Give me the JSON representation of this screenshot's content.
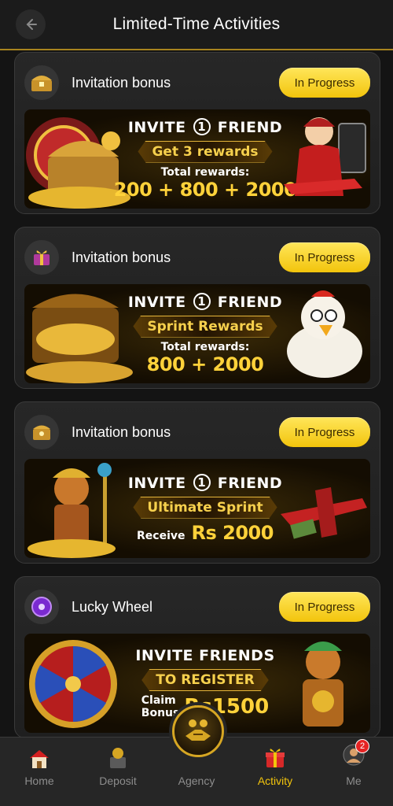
{
  "header": {
    "title": "Limited-Time Activities"
  },
  "activities": [
    {
      "title": "Invitation bonus",
      "status": "In Progress",
      "icon": "treasure-chest-icon",
      "banner": {
        "line1_pre": "INVITE",
        "line1_num": "1",
        "line1_post": "FRIEND",
        "ribbon": "Get 3 rewards",
        "line3": "Total rewards:",
        "line4": "200 + 800 + 2000"
      }
    },
    {
      "title": "Invitation bonus",
      "status": "In Progress",
      "icon": "gift-icon",
      "banner": {
        "line1_pre": "INVITE",
        "line1_num": "1",
        "line1_post": "FRIEND",
        "ribbon": "Sprint Rewards",
        "line3": "Total rewards:",
        "line4": "800 + 2000"
      }
    },
    {
      "title": "Invitation bonus",
      "status": "In Progress",
      "icon": "treasure-box-icon",
      "banner": {
        "line1_pre": "INVITE",
        "line1_num": "1",
        "line1_post": "FRIEND",
        "ribbon": "Ultimate Sprint",
        "line3": "Receive",
        "line4": "Rs 2000"
      }
    },
    {
      "title": "Lucky Wheel",
      "status": "In Progress",
      "icon": "lucky-wheel-icon",
      "banner": {
        "line1": "INVITE FRIENDS",
        "ribbon": "TO REGISTER",
        "claim_a": "Claim",
        "claim_b": "Bonus",
        "amount": "Rs1500"
      }
    }
  ],
  "nav": [
    {
      "label": "Home",
      "icon": "home-icon"
    },
    {
      "label": "Deposit",
      "icon": "deposit-icon"
    },
    {
      "label": "Agency",
      "icon": "agency-handshake-icon"
    },
    {
      "label": "Activity",
      "icon": "gift-box-icon",
      "active": true
    },
    {
      "label": "Me",
      "icon": "avatar-icon",
      "badge": "2"
    }
  ],
  "colors": {
    "accent": "#f2c40c",
    "background": "#141414",
    "card": "#262626"
  }
}
